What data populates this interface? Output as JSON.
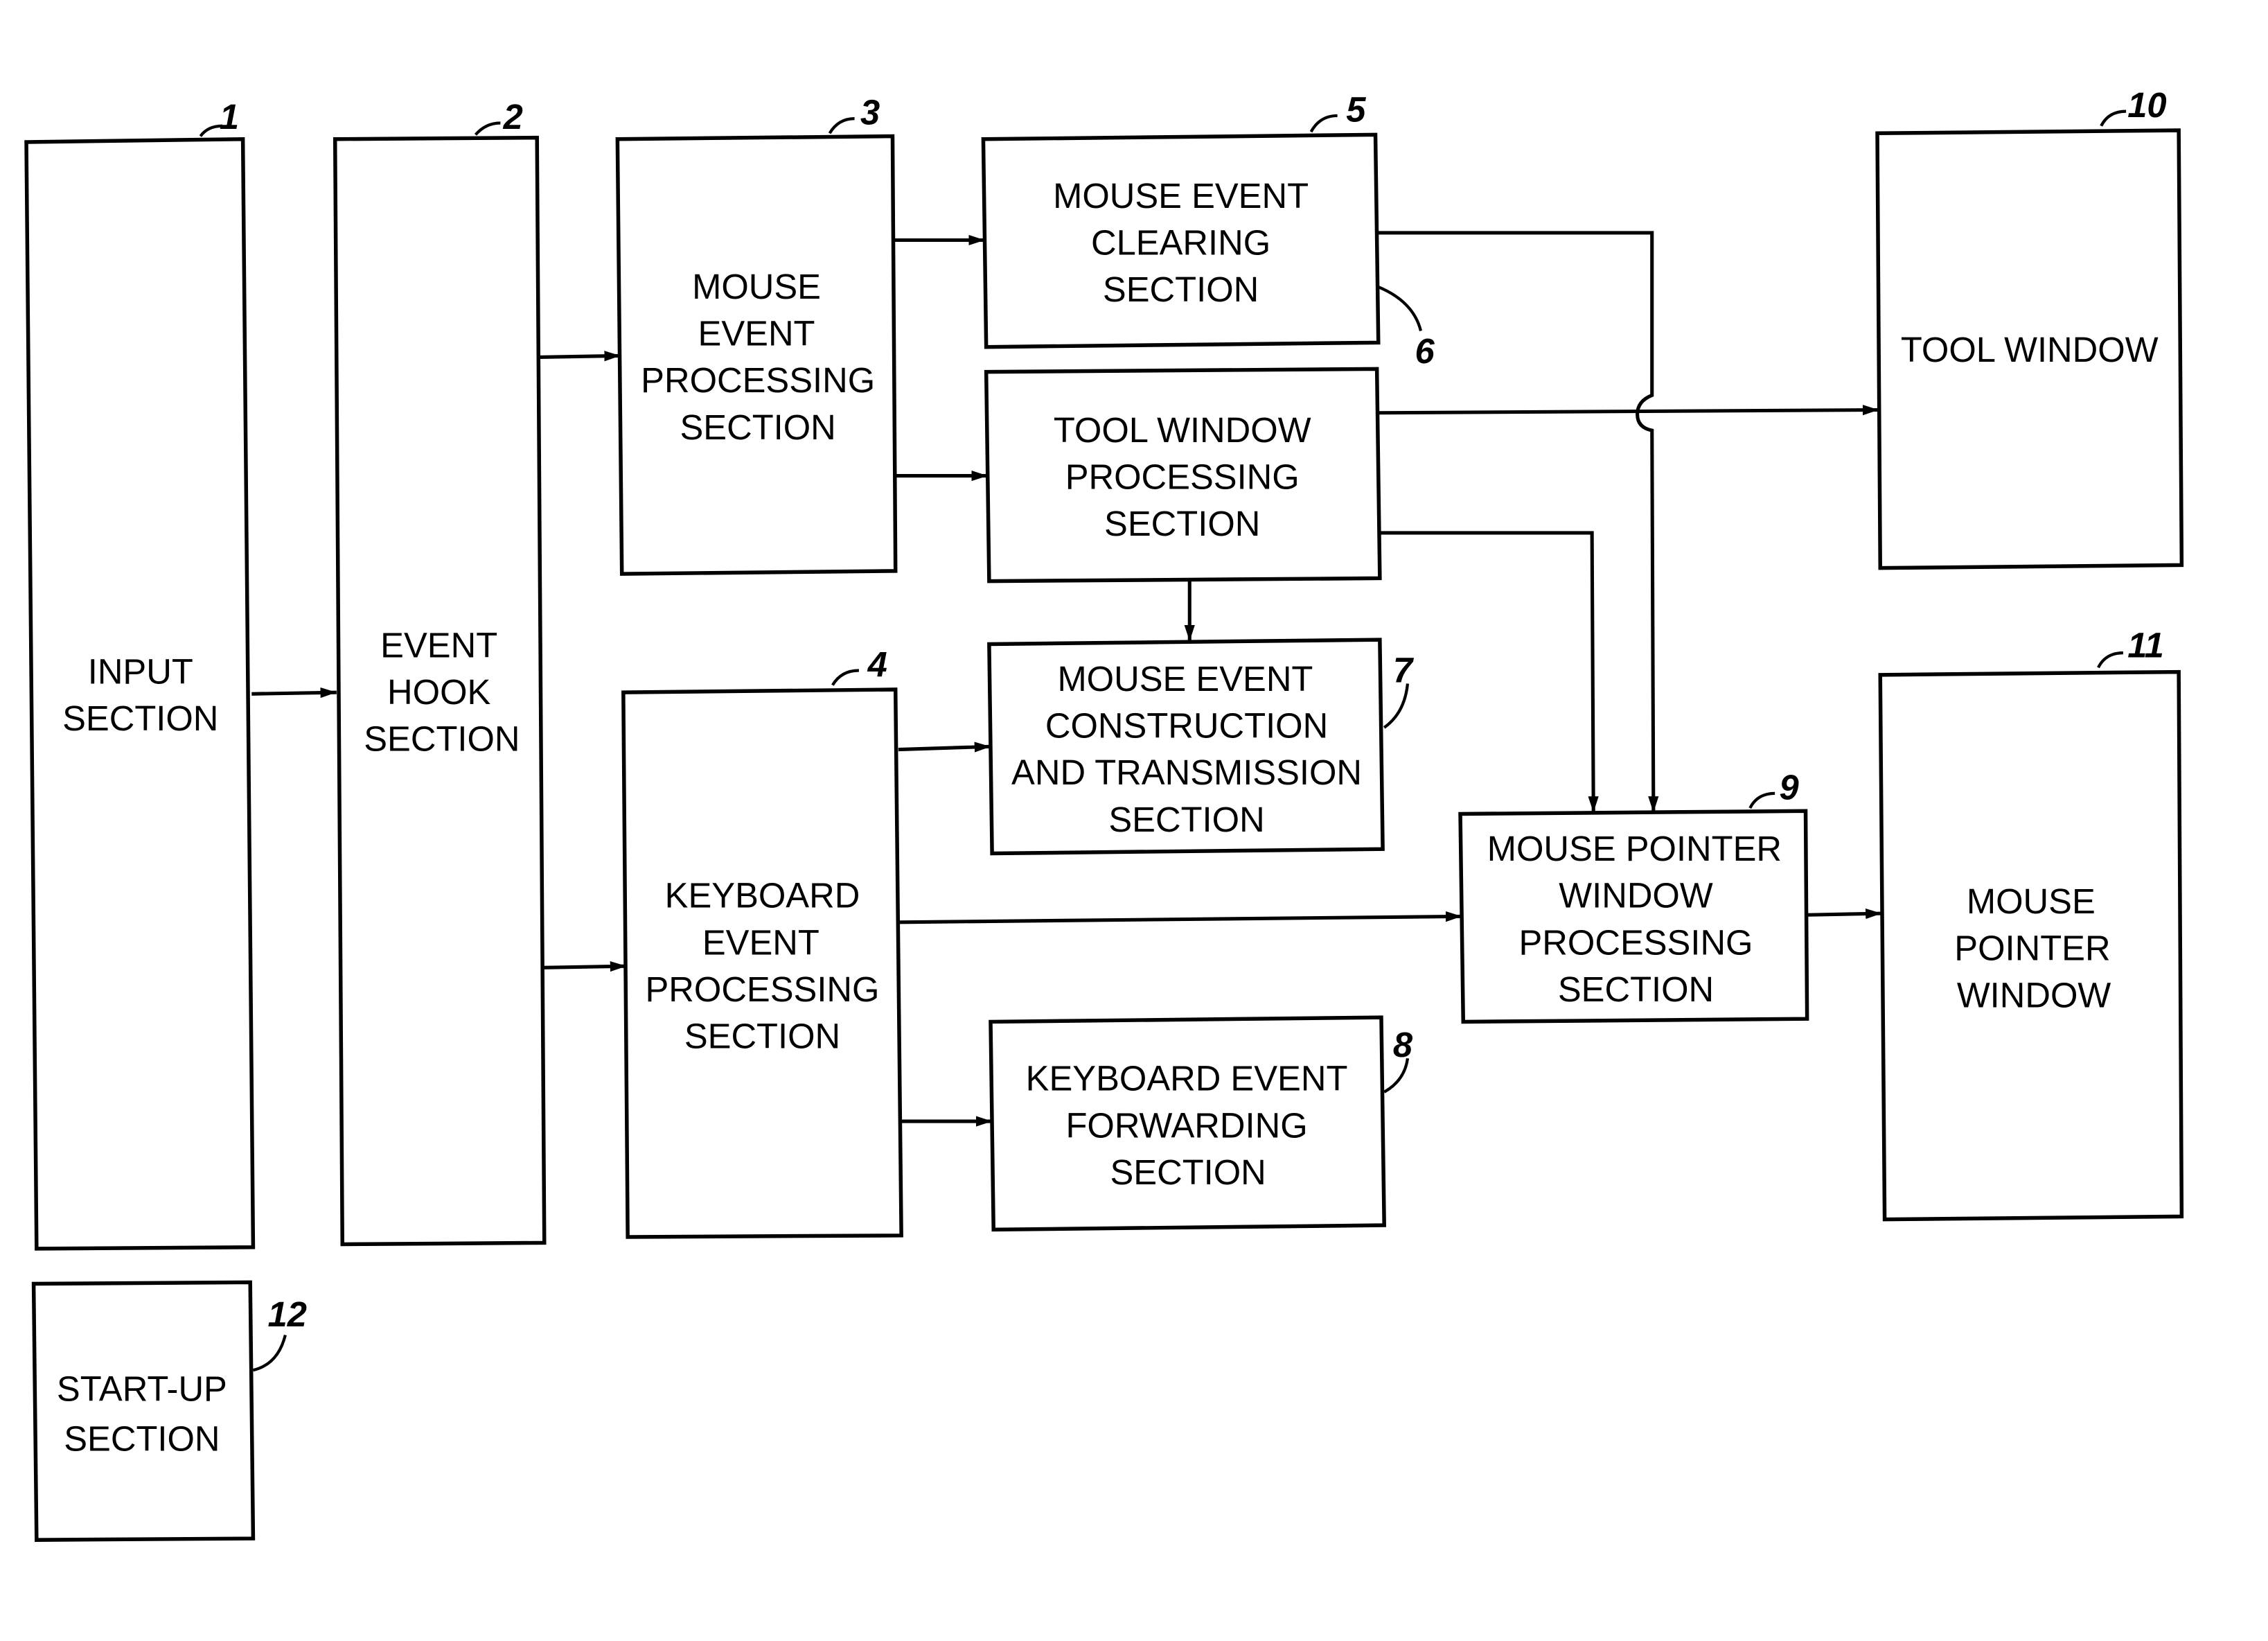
{
  "blocks": {
    "b1": {
      "ref": "1",
      "lines": [
        "INPUT",
        "SECTION"
      ]
    },
    "b2": {
      "ref": "2",
      "lines": [
        "EVENT",
        "HOOK",
        "SECTION"
      ]
    },
    "b3": {
      "ref": "3",
      "lines": [
        "MOUSE",
        "EVENT",
        "PROCESSING",
        "SECTION"
      ]
    },
    "b4": {
      "ref": "4",
      "lines": [
        "KEYBOARD",
        "EVENT",
        "PROCESSING",
        "SECTION"
      ]
    },
    "b5": {
      "ref": "5",
      "lines": [
        "MOUSE EVENT",
        "CLEARING",
        "SECTION"
      ]
    },
    "b6": {
      "ref": "6"
    },
    "b7": {
      "ref": "7",
      "lines": [
        "MOUSE EVENT",
        "CONSTRUCTION",
        "AND TRANSMISSION",
        "SECTION"
      ]
    },
    "b8": {
      "ref": "8",
      "lines": [
        "KEYBOARD EVENT",
        "FORWARDING",
        "SECTION"
      ]
    },
    "b9": {
      "ref": "9",
      "lines": [
        "MOUSE POINTER",
        "WINDOW",
        "PROCESSING",
        "SECTION"
      ]
    },
    "tw": {
      "ref": "10",
      "lines": [
        "TOOL WINDOW"
      ]
    },
    "b11": {
      "ref": "11",
      "lines": [
        "MOUSE",
        "POINTER",
        "WINDOW"
      ]
    },
    "b12": {
      "ref": "12",
      "lines": [
        "START-UP",
        "SECTION"
      ]
    }
  },
  "connections": [
    {
      "from": "1",
      "to": "2"
    },
    {
      "from": "2",
      "to": "3"
    },
    {
      "from": "2",
      "to": "4"
    },
    {
      "from": "3",
      "to": "5"
    },
    {
      "from": "3",
      "to": "tool-window-processing"
    },
    {
      "from": "tool-window-processing",
      "to": "10"
    },
    {
      "from": "tool-window-processing",
      "to": "7"
    },
    {
      "from": "tool-window-processing",
      "to": "9"
    },
    {
      "from": "5",
      "to": "9"
    },
    {
      "from": "4",
      "to": "7"
    },
    {
      "from": "4",
      "to": "9"
    },
    {
      "from": "4",
      "to": "8"
    },
    {
      "from": "9",
      "to": "11"
    }
  ],
  "tool_window_processing": {
    "lines": [
      "TOOL WINDOW",
      "PROCESSING",
      "SECTION"
    ]
  }
}
